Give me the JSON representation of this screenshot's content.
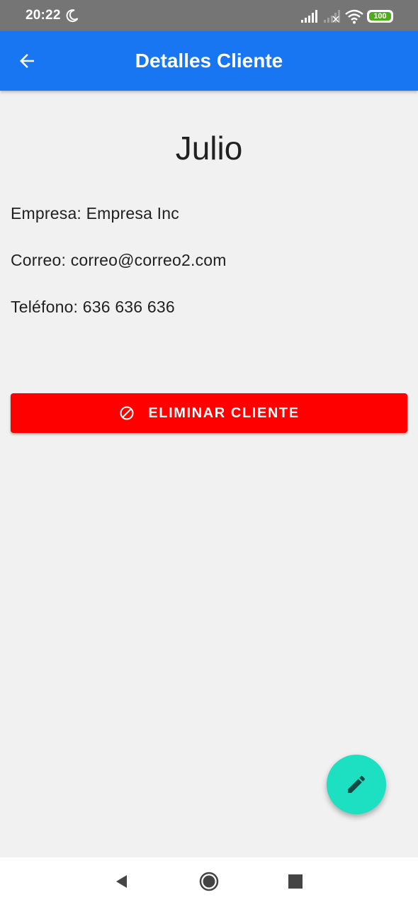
{
  "status_bar": {
    "time": "20:22",
    "battery": "100"
  },
  "app_bar": {
    "title": "Detalles Cliente",
    "back_icon": "arrow-back-icon"
  },
  "client": {
    "name": "Julio",
    "empresa_label": "Empresa:",
    "empresa_value": "Empresa Inc",
    "correo_label": "Correo:",
    "correo_value": "correo@correo2.com",
    "telefono_label": "Teléfono:",
    "telefono_value": "636 636 636"
  },
  "delete_button": {
    "label": "ELIMINAR CLIENTE",
    "icon": "block-icon",
    "color": "#ff0000"
  },
  "fab": {
    "icon": "pencil-icon",
    "color": "#1de0c3"
  },
  "colors": {
    "app_bar": "#1976f2",
    "status_bar": "#757575",
    "background": "#f1f1f1"
  }
}
